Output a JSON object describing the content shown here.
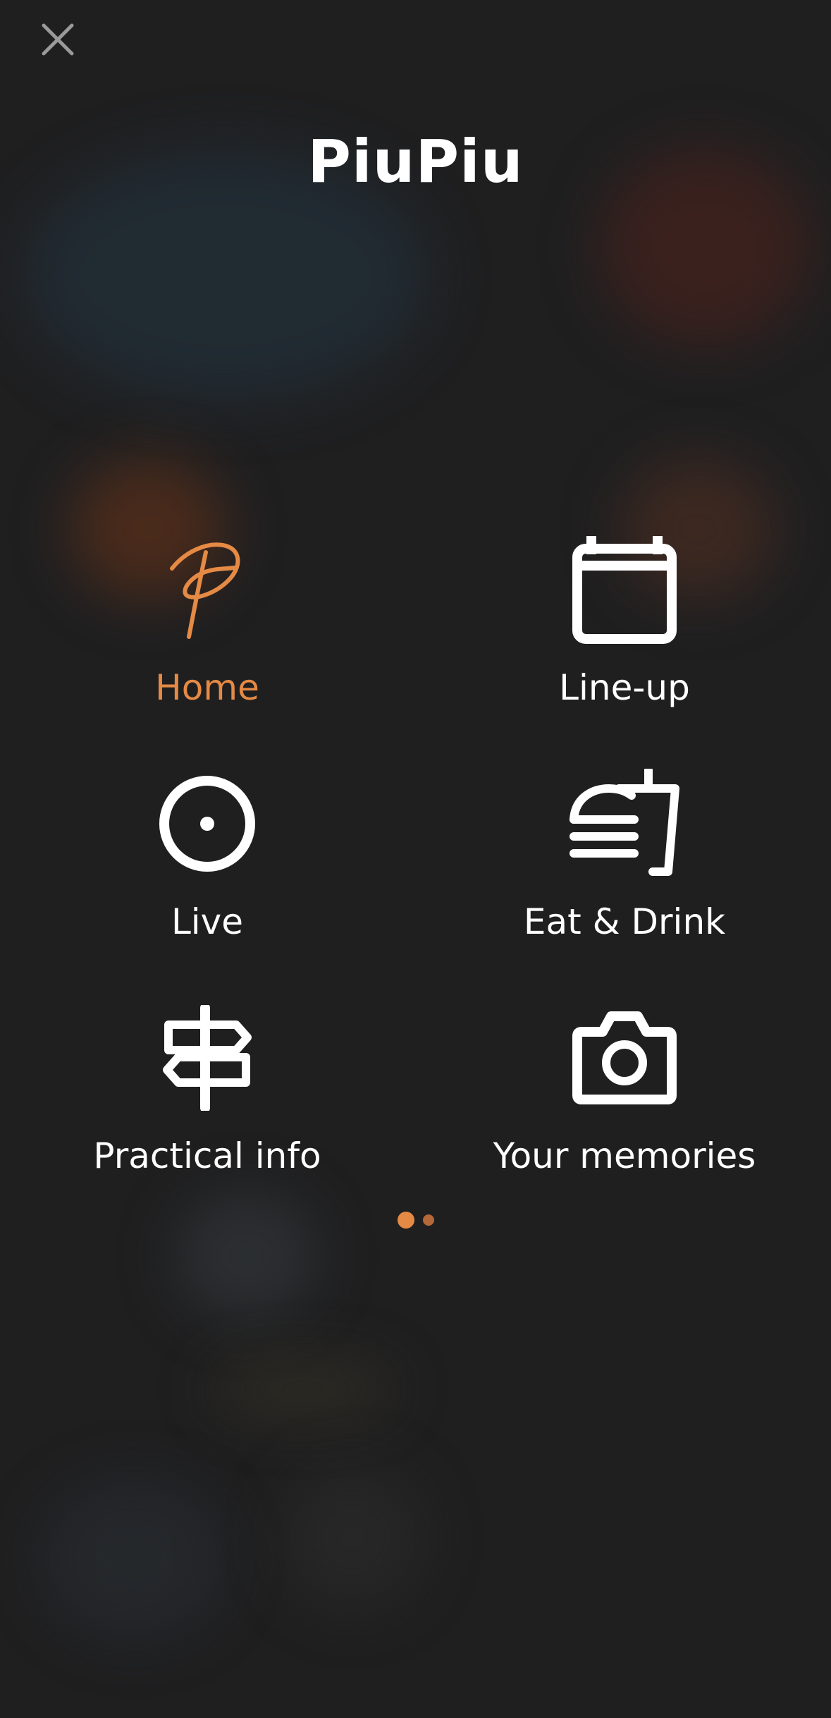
{
  "app_title": "PiuPiu",
  "colors": {
    "accent": "#e58a45",
    "background": "#1f1f20",
    "text": "#ffffff",
    "icon_close": "#9a9a9a"
  },
  "close_icon": "close-icon",
  "menu": {
    "items": [
      {
        "label": "Home",
        "icon": "piupiu-logo-icon",
        "active": true
      },
      {
        "label": "Line-up",
        "icon": "calendar-icon",
        "active": false
      },
      {
        "label": "Live",
        "icon": "live-record-icon",
        "active": false
      },
      {
        "label": "Eat & Drink",
        "icon": "burger-drink-icon",
        "active": false
      },
      {
        "label": "Practical info",
        "icon": "signpost-icon",
        "active": false
      },
      {
        "label": "Your memories",
        "icon": "camera-icon",
        "active": false
      }
    ]
  },
  "pager": {
    "pages": 2,
    "current_page": 1
  }
}
